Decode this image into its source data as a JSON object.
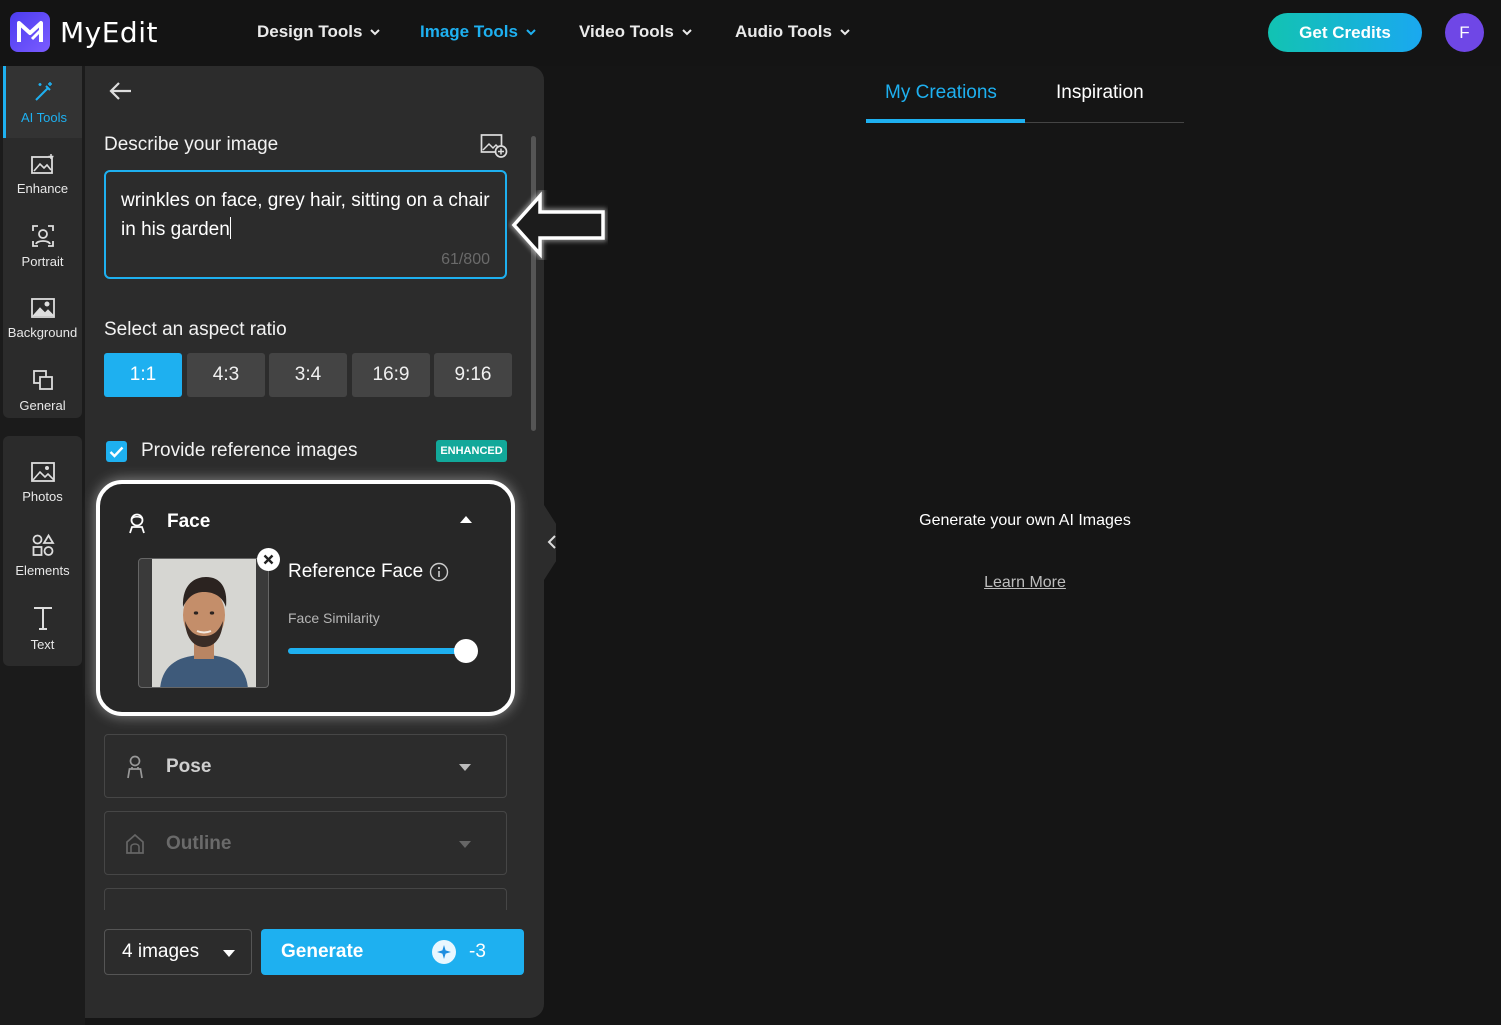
{
  "app": {
    "name": "MyEdit",
    "logo_letter": "M"
  },
  "nav": {
    "items": [
      {
        "label": "Design Tools",
        "active": false
      },
      {
        "label": "Image Tools",
        "active": true
      },
      {
        "label": "Video Tools",
        "active": false
      },
      {
        "label": "Audio Tools",
        "active": false
      }
    ],
    "credits_label": "Get Credits",
    "avatar_initial": "F"
  },
  "rail": {
    "items": [
      {
        "label": "AI Tools",
        "icon": "magic-wand-icon",
        "active": true
      },
      {
        "label": "Enhance",
        "icon": "image-sparkle-icon"
      },
      {
        "label": "Portrait",
        "icon": "portrait-icon"
      },
      {
        "label": "Background",
        "icon": "background-icon"
      },
      {
        "label": "General",
        "icon": "layers-icon"
      },
      {
        "label": "Photos",
        "icon": "photo-icon"
      },
      {
        "label": "Elements",
        "icon": "shapes-icon"
      },
      {
        "label": "Text",
        "icon": "text-icon"
      }
    ]
  },
  "panel": {
    "describe_label": "Describe your image",
    "prompt_value": "wrinkles on face, grey hair, sitting on a chair in his garden",
    "prompt_counter": "61/800",
    "aspect_label": "Select an aspect ratio",
    "aspect_ratios": [
      "1:1",
      "4:3",
      "3:4",
      "16:9",
      "9:16"
    ],
    "aspect_selected": "1:1",
    "reference_label": "Provide reference images",
    "reference_checked": true,
    "enhanced_badge": "ENHANCED",
    "face": {
      "title": "Face",
      "reference_label": "Reference Face",
      "similarity_label": "Face Similarity",
      "similarity_value": 1.0
    },
    "pose_title": "Pose",
    "outline_title": "Outline",
    "image_count": "4 images",
    "generate_label": "Generate",
    "generate_cost": "-3"
  },
  "main": {
    "tabs": [
      {
        "label": "My Creations",
        "active": true
      },
      {
        "label": "Inspiration",
        "active": false
      }
    ],
    "empty_message": "Generate your own AI Images",
    "learn_more": "Learn More"
  },
  "colors": {
    "accent": "#1eb0f0",
    "panel": "#2c2c2c",
    "background": "#151515",
    "badge": "#12a89a"
  }
}
